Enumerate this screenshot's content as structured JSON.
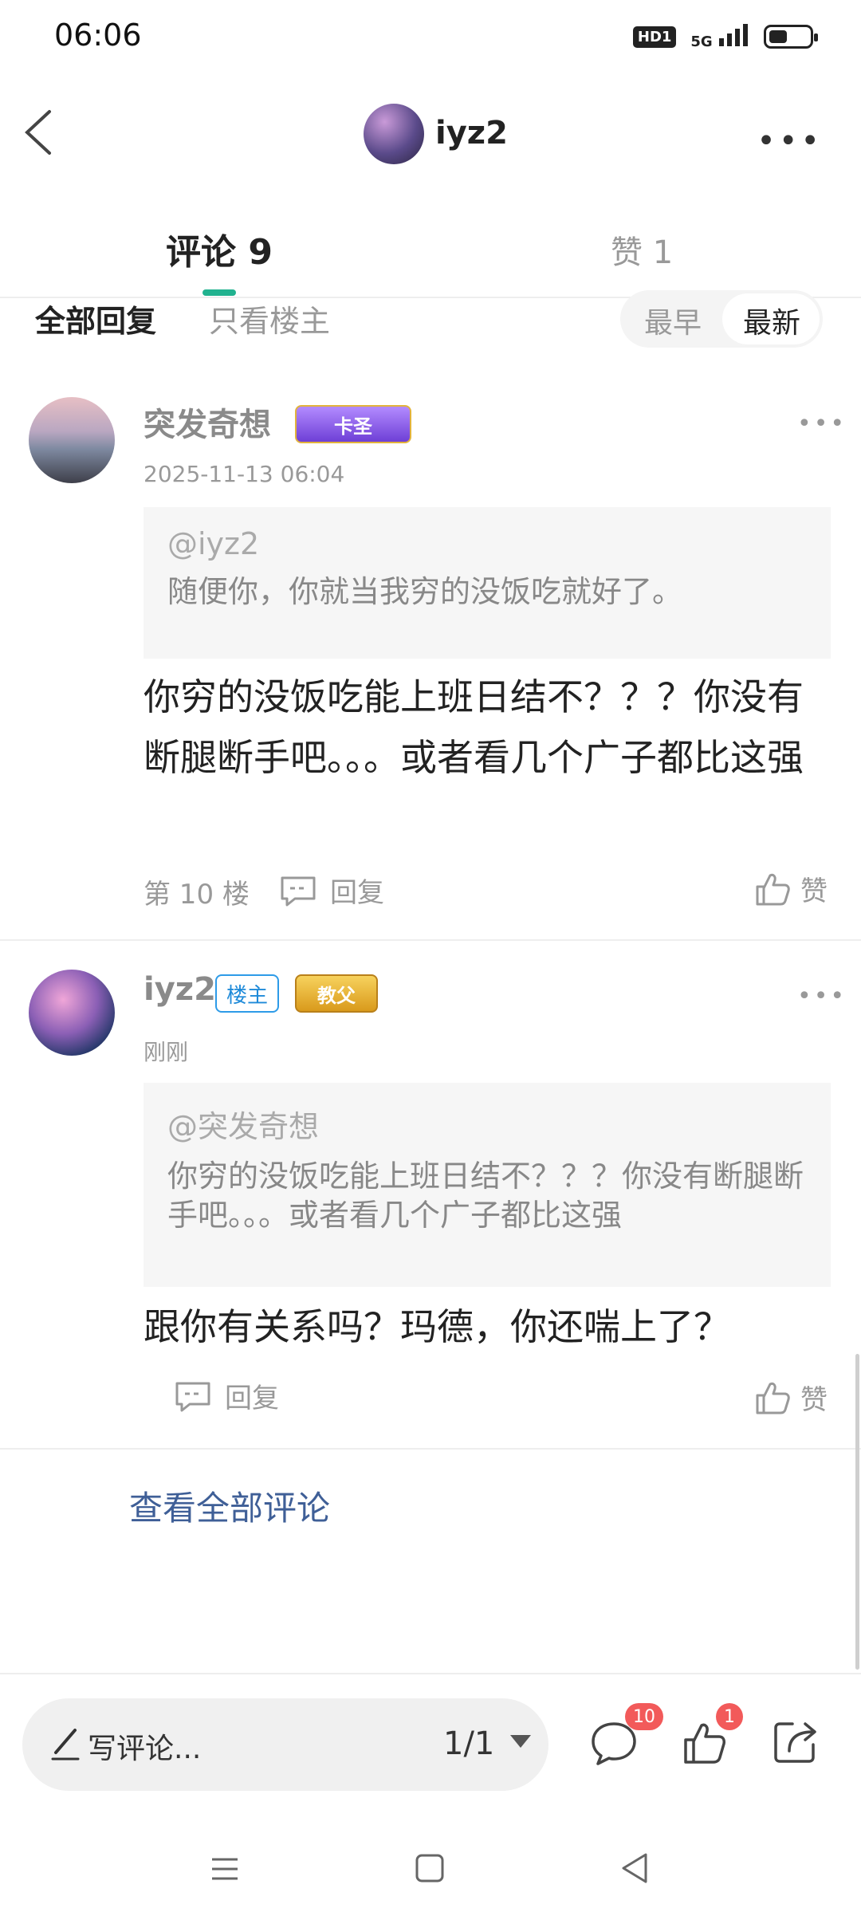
{
  "status_bar": {
    "time": "06:06",
    "hd": "HD1",
    "network": "5G"
  },
  "header": {
    "username": "iyz2"
  },
  "tabs": {
    "comments_label": "评论 9",
    "likes_label": "赞 1"
  },
  "filter": {
    "all": "全部回复",
    "owner_only": "只看楼主",
    "earliest": "最早",
    "latest": "最新"
  },
  "comments": [
    {
      "username": "突发奇想",
      "badge": "卡圣",
      "timestamp": "2025-11-13 06:04",
      "quote_mention": "@iyz2",
      "quote_text": "随便你，你就当我穷的没饭吃就好了。",
      "text": "你穷的没饭吃能上班日结不？？？你没有断腿断手吧。。。或者看几个广子都比这强",
      "floor": "第 10 楼",
      "reply": "回复",
      "like": "赞"
    },
    {
      "username": "iyz2",
      "owner_badge": "楼主",
      "badge": "教父",
      "timestamp": "刚刚",
      "quote_mention": "@突发奇想",
      "quote_text": "你穷的没饭吃能上班日结不？？？你没有断腿断手吧。。。或者看几个广子都比这强",
      "text": "跟你有关系吗？玛德，你还喘上了？",
      "reply": "回复",
      "like": "赞"
    }
  ],
  "view_all": "查看全部评论",
  "bottom_bar": {
    "write_placeholder": "写评论...",
    "page": "1/1",
    "comment_count": "10",
    "like_count": "1"
  }
}
